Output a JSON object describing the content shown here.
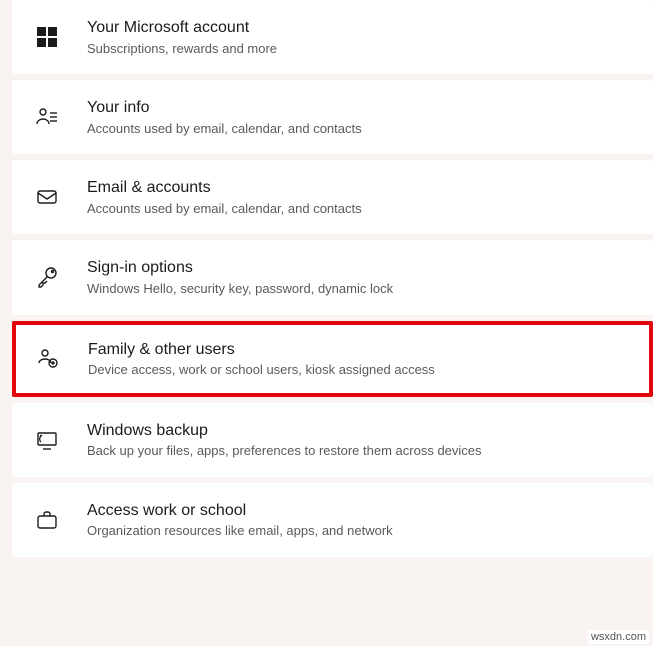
{
  "items": [
    {
      "icon": "microsoft-logo-icon",
      "title": "Your Microsoft account",
      "subtitle": "Subscriptions, rewards and more",
      "highlight": false
    },
    {
      "icon": "person-info-icon",
      "title": "Your info",
      "subtitle": "Accounts used by email, calendar, and contacts",
      "highlight": false
    },
    {
      "icon": "mail-icon",
      "title": "Email & accounts",
      "subtitle": "Accounts used by email, calendar, and contacts",
      "highlight": false
    },
    {
      "icon": "key-icon",
      "title": "Sign-in options",
      "subtitle": "Windows Hello, security key, password, dynamic lock",
      "highlight": false
    },
    {
      "icon": "family-users-icon",
      "title": "Family & other users",
      "subtitle": "Device access, work or school users, kiosk assigned access",
      "highlight": true
    },
    {
      "icon": "backup-icon",
      "title": "Windows backup",
      "subtitle": "Back up your files, apps, preferences to restore them across devices",
      "highlight": false
    },
    {
      "icon": "briefcase-icon",
      "title": "Access work or school",
      "subtitle": "Organization resources like email, apps, and network",
      "highlight": false
    }
  ],
  "watermark": "wsxdn.com"
}
